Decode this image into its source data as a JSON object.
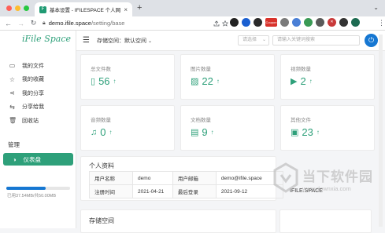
{
  "browser": {
    "tab_title": "基本设置 - IFILESPACE 个人网盘",
    "tab_favicon": "F",
    "tab_close": "×",
    "new_tab": "+",
    "tab_menu": "⌄",
    "url_host": "demo.ifile.space",
    "url_path": "/setting/base",
    "nav": {
      "back": "←",
      "forward": "→",
      "reload": "↻"
    },
    "extensions": [
      {
        "name": "circle-ext",
        "label": "",
        "color": "#222222"
      },
      {
        "name": "vpn-ext",
        "label": "",
        "color": "#1a5fd1"
      },
      {
        "name": "cookie-ext",
        "label": "",
        "color": "#2a2a2a"
      },
      {
        "name": "tag-ext",
        "label": "Coupon",
        "color": "#d8322b"
      },
      {
        "name": "image-ext",
        "label": "",
        "color": "#7a7a7a"
      },
      {
        "name": "puzzle-ext",
        "label": "",
        "color": "#4a7fd6"
      },
      {
        "name": "shield-ext",
        "label": "",
        "color": "#3a9a55"
      },
      {
        "name": "grid-ext",
        "label": "",
        "color": "#5a5a5a"
      },
      {
        "name": "x-ext",
        "label": "✕",
        "color": "#c93a3a"
      },
      {
        "name": "music-ext",
        "label": "",
        "color": "#333333"
      },
      {
        "name": "profile-avatar",
        "label": "",
        "color": "#1d6b52"
      }
    ],
    "menu_dots": "⋮"
  },
  "sidebar": {
    "logo": "iFile Space",
    "items": [
      {
        "label": "我的文件",
        "icon": "▭"
      },
      {
        "label": "我的收藏",
        "icon": "☆"
      },
      {
        "label": "我的分享",
        "icon": "⋖"
      },
      {
        "label": "分享给我",
        "icon": "⇆"
      },
      {
        "label": "回收站",
        "icon": "🗑"
      }
    ],
    "manage_label": "管理",
    "dashboard_label": "仪表盘",
    "dashboard_icon": "◑",
    "storage_used_fraction": 0.62,
    "storage_text": "已用37.54MB/共50.00MB"
  },
  "topbar": {
    "menu_icon": "☰",
    "space_label": "存储空间：",
    "space_value": "默认空间",
    "space_chevron": "⌄",
    "select_placeholder": "请选择",
    "select_chevron": "⌄",
    "search_placeholder": "请输入关键词搜索",
    "power_icon": "⏻"
  },
  "stats": [
    {
      "label": "总文件数",
      "value": "56",
      "icon": "▯",
      "arrow": "↑"
    },
    {
      "label": "图片数量",
      "value": "22",
      "icon": "▨",
      "arrow": "↑"
    },
    {
      "label": "视频数量",
      "value": "2",
      "icon": "▶",
      "arrow": "↑"
    },
    {
      "label": "音频数量",
      "value": "0",
      "icon": "♫",
      "arrow": "↑"
    },
    {
      "label": "文档数量",
      "value": "9",
      "icon": "▤",
      "arrow": "↑"
    },
    {
      "label": "其他文件",
      "value": "23",
      "icon": "▣",
      "arrow": "↑"
    }
  ],
  "profile": {
    "title": "个人资料",
    "rows": [
      {
        "k1": "用户名称",
        "v1": "demo",
        "k2": "用户邮箱",
        "v2": "demo@ifile.space"
      },
      {
        "k1": "注册时间",
        "v1": "2021-04-21",
        "k2": "最后登录",
        "v2": "2021-09-12"
      }
    ]
  },
  "storage_section": {
    "title": "存储空间",
    "ifile_label": "IFILE.SPACE"
  },
  "watermark": {
    "text": "当下软件园",
    "url": "www.downxia.com"
  },
  "colors": {
    "accent": "#2ea07a",
    "blue": "#1677d2"
  }
}
